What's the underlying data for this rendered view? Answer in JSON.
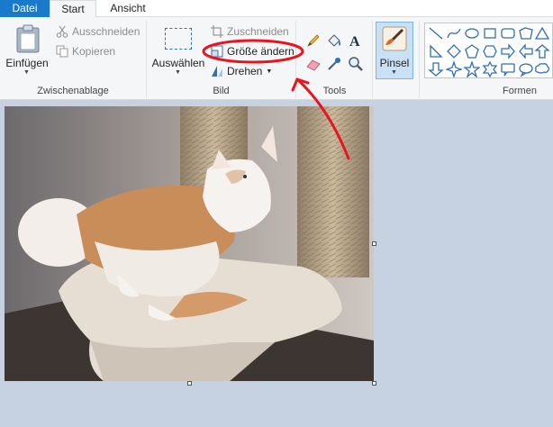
{
  "menu": {
    "file": "Datei",
    "tabs": [
      "Start",
      "Ansicht"
    ]
  },
  "clipboard": {
    "paste": "Einfügen",
    "cut": "Ausschneiden",
    "copy": "Kopieren",
    "group": "Zwischenablage"
  },
  "image": {
    "select": "Auswählen",
    "crop": "Zuschneiden",
    "resize": "Größe ändern",
    "rotate": "Drehen",
    "group": "Bild"
  },
  "tools": {
    "group": "Tools",
    "items": [
      "pencil-icon",
      "fill-icon",
      "text-icon",
      "eraser-icon",
      "color-picker-icon",
      "magnifier-icon"
    ]
  },
  "brush": {
    "label": "Pinsel"
  },
  "shapes": {
    "group": "Formen",
    "items": [
      "line",
      "curve",
      "oval",
      "rectangle",
      "rounded-rectangle",
      "polygon",
      "triangle",
      "right-triangle",
      "diamond",
      "pentagon",
      "hexagon",
      "right-arrow",
      "left-arrow",
      "up-arrow",
      "down-arrow",
      "four-point-star",
      "five-point-star",
      "six-point-star",
      "rounded-callout",
      "oval-callout",
      "cloud-callout"
    ]
  },
  "colors": {
    "file_tab": "#1979ca",
    "annotation": "#e8141e",
    "canvas_bg": "#c6d2e2",
    "selected_tool": "#c9e0f7"
  }
}
